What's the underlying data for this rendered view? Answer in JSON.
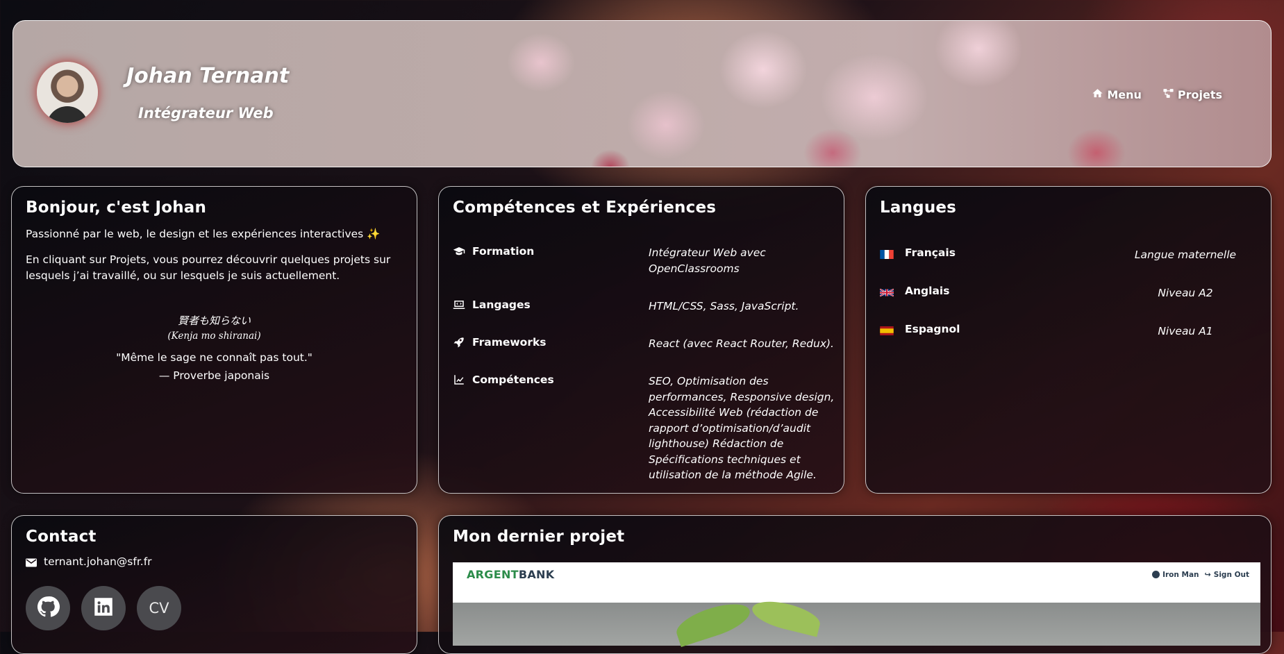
{
  "header": {
    "name": "Johan Ternant",
    "role": "Intégrateur Web",
    "nav": [
      {
        "label": "Menu",
        "icon": "home-icon"
      },
      {
        "label": "Projets",
        "icon": "share-nodes-icon"
      }
    ]
  },
  "intro": {
    "title": "Bonjour, c'est Johan",
    "p1": "Passionné par le web, le design et les expériences interactives ✨",
    "p2": "En cliquant sur Projets, vous pourrez découvrir quelques projets sur lesquels j’ai travaillé, ou sur lesquels je suis actuellement.",
    "quote_jp": "賢者も知らない",
    "quote_romaji": "(Kenja mo shiranai)",
    "quote_fr": "\"Même le sage ne connaît pas tout.\"",
    "quote_source": "— Proverbe japonais"
  },
  "skills": {
    "title": "Compétences et Expériences",
    "items": [
      {
        "label": "Formation",
        "icon": "graduation-cap-icon",
        "value": "Intégrateur Web avec OpenClassrooms"
      },
      {
        "label": "Langages",
        "icon": "laptop-code-icon",
        "value": "HTML/CSS, Sass, JavaScript."
      },
      {
        "label": "Frameworks",
        "icon": "rocket-icon",
        "value": "React (avec React Router, Redux)."
      },
      {
        "label": "Compétences",
        "icon": "chart-line-icon",
        "value": "SEO, Optimisation des performances, Responsive design, Accessibilité Web (rédaction de rapport d’optimisation/d’audit lighthouse) Rédaction de Spécifications techniques et utilisation de la méthode Agile."
      }
    ]
  },
  "languages": {
    "title": "Langues",
    "items": [
      {
        "label": "Français",
        "flag": "flag-france-icon",
        "level": "Langue maternelle"
      },
      {
        "label": "Anglais",
        "flag": "flag-uk-icon",
        "level": "Niveau A2"
      },
      {
        "label": "Espagnol",
        "flag": "flag-spain-icon",
        "level": "Niveau A1"
      }
    ]
  },
  "contact": {
    "title": "Contact",
    "email": "ternant.johan@sfr.fr",
    "social": [
      {
        "name": "github-icon"
      },
      {
        "name": "linkedin-icon"
      },
      {
        "name": "cv",
        "label": "CV"
      }
    ]
  },
  "project": {
    "title": "Mon dernier projet",
    "preview": {
      "brand_argent": "ARGENT",
      "brand_bank": "BANK",
      "user": "Iron Man",
      "signout": "Sign Out"
    }
  },
  "colors": {
    "accent_green": "#2c8c4a",
    "social_bg": "#4a4a4e"
  }
}
